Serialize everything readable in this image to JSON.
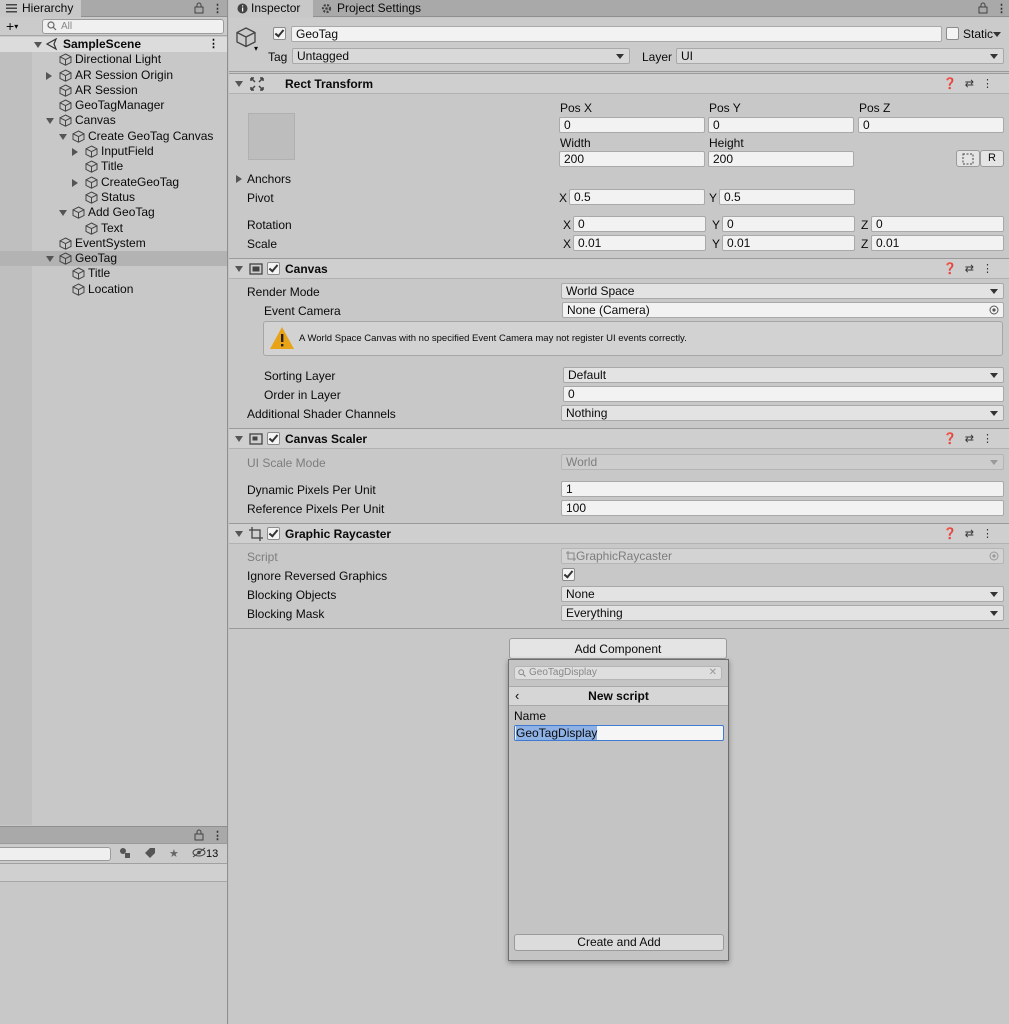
{
  "hierarchy": {
    "tab": "Hierarchy",
    "search_placeholder": "All",
    "scene": "SampleScene",
    "items": [
      {
        "label": "Directional Light",
        "depth": 1,
        "expander": "none"
      },
      {
        "label": "AR Session Origin",
        "depth": 1,
        "expander": "collapsed"
      },
      {
        "label": "AR Session",
        "depth": 1,
        "expander": "none"
      },
      {
        "label": "GeoTagManager",
        "depth": 1,
        "expander": "none"
      },
      {
        "label": "Canvas",
        "depth": 1,
        "expander": "expanded"
      },
      {
        "label": "Create GeoTag Canvas",
        "depth": 2,
        "expander": "expanded"
      },
      {
        "label": "InputField",
        "depth": 3,
        "expander": "collapsed"
      },
      {
        "label": "Title",
        "depth": 3,
        "expander": "none"
      },
      {
        "label": "CreateGeoTag",
        "depth": 3,
        "expander": "collapsed"
      },
      {
        "label": "Status",
        "depth": 3,
        "expander": "none"
      },
      {
        "label": "Add GeoTag",
        "depth": 2,
        "expander": "expanded"
      },
      {
        "label": "Text",
        "depth": 3,
        "expander": "none"
      },
      {
        "label": "EventSystem",
        "depth": 1,
        "expander": "none"
      },
      {
        "label": "GeoTag",
        "depth": 1,
        "expander": "expanded",
        "selected": true
      },
      {
        "label": "Title",
        "depth": 2,
        "expander": "none"
      },
      {
        "label": "Location",
        "depth": 2,
        "expander": "none"
      }
    ]
  },
  "project": {
    "hidden_count": "13"
  },
  "inspector": {
    "tabs": [
      "Inspector",
      "Project Settings"
    ],
    "object": {
      "name": "GeoTag",
      "static_label": "Static",
      "tag_label": "Tag",
      "tag_value": "Untagged",
      "layer_label": "Layer",
      "layer_value": "UI"
    },
    "rect": {
      "title": "Rect Transform",
      "pos_x_label": "Pos X",
      "pos_y_label": "Pos Y",
      "pos_z_label": "Pos Z",
      "pos_x": "0",
      "pos_y": "0",
      "pos_z": "0",
      "width_label": "Width",
      "height_label": "Height",
      "width": "200",
      "height": "200",
      "r_button": "R",
      "anchors_label": "Anchors",
      "pivot_label": "Pivot",
      "pivot_x": "0.5",
      "pivot_y": "0.5",
      "rotation_label": "Rotation",
      "rot_x": "0",
      "rot_y": "0",
      "rot_z": "0",
      "scale_label": "Scale",
      "scale_x": "0.01",
      "scale_y": "0.01",
      "scale_z": "0.01",
      "x": "X",
      "y": "Y",
      "z": "Z"
    },
    "canvas": {
      "title": "Canvas",
      "render_mode_label": "Render Mode",
      "render_mode": "World Space",
      "event_camera_label": "Event Camera",
      "event_camera": "None (Camera)",
      "warning": "A World Space Canvas with no specified Event Camera may not register UI events correctly.",
      "sorting_layer_label": "Sorting Layer",
      "sorting_layer": "Default",
      "order_label": "Order in Layer",
      "order": "0",
      "shader_label": "Additional Shader Channels",
      "shader": "Nothing"
    },
    "scaler": {
      "title": "Canvas Scaler",
      "mode_label": "UI Scale Mode",
      "mode": "World",
      "dpu_label": "Dynamic Pixels Per Unit",
      "dpu": "1",
      "rpu_label": "Reference Pixels Per Unit",
      "rpu": "100"
    },
    "raycaster": {
      "title": "Graphic Raycaster",
      "script_label": "Script",
      "script": "GraphicRaycaster",
      "ignore_label": "Ignore Reversed Graphics",
      "blocking_label": "Blocking Objects",
      "blocking": "None",
      "mask_label": "Blocking Mask",
      "mask": "Everything"
    },
    "add_component": "Add Component",
    "popup": {
      "search": "GeoTagDisplay",
      "title": "New script",
      "name_label": "Name",
      "name_value": "GeoTagDisplay",
      "create_button": "Create and Add"
    }
  }
}
